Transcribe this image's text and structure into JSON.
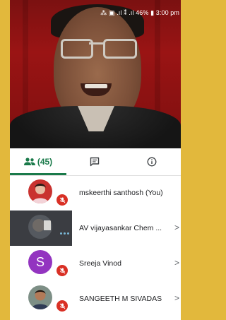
{
  "status_bar": {
    "text": "⁂ ▣ .ıl ⁑ .ıl 46% ▮ 3:00 pm",
    "battery": "46%",
    "time": "3:00 pm"
  },
  "tabs": [
    {
      "name": "people",
      "icon": "people-icon",
      "count": "(45)",
      "selected": true
    },
    {
      "name": "chat",
      "icon": "chat-icon"
    },
    {
      "name": "info",
      "icon": "info-icon"
    }
  ],
  "participants": [
    {
      "name": "mskeerthi santhosh (You)",
      "avatar": "photo",
      "mic": "muted"
    },
    {
      "name": "AV vijayasankar Chem ...",
      "avatar": "photo",
      "mic": "speaking",
      "chevron": ">"
    },
    {
      "name": "Sreeja Vinod",
      "avatar": "letter",
      "letter": "S",
      "mic": "muted",
      "chevron": ">"
    },
    {
      "name": "SANGEETH M SIVADAS",
      "avatar": "photo",
      "mic": "muted",
      "chevron": ">"
    }
  ],
  "colors": {
    "accent": "#1a7a4a",
    "mute_red": "#d93025",
    "avatar_purple": "#9334c0",
    "background_frame": "#e2b83c"
  }
}
